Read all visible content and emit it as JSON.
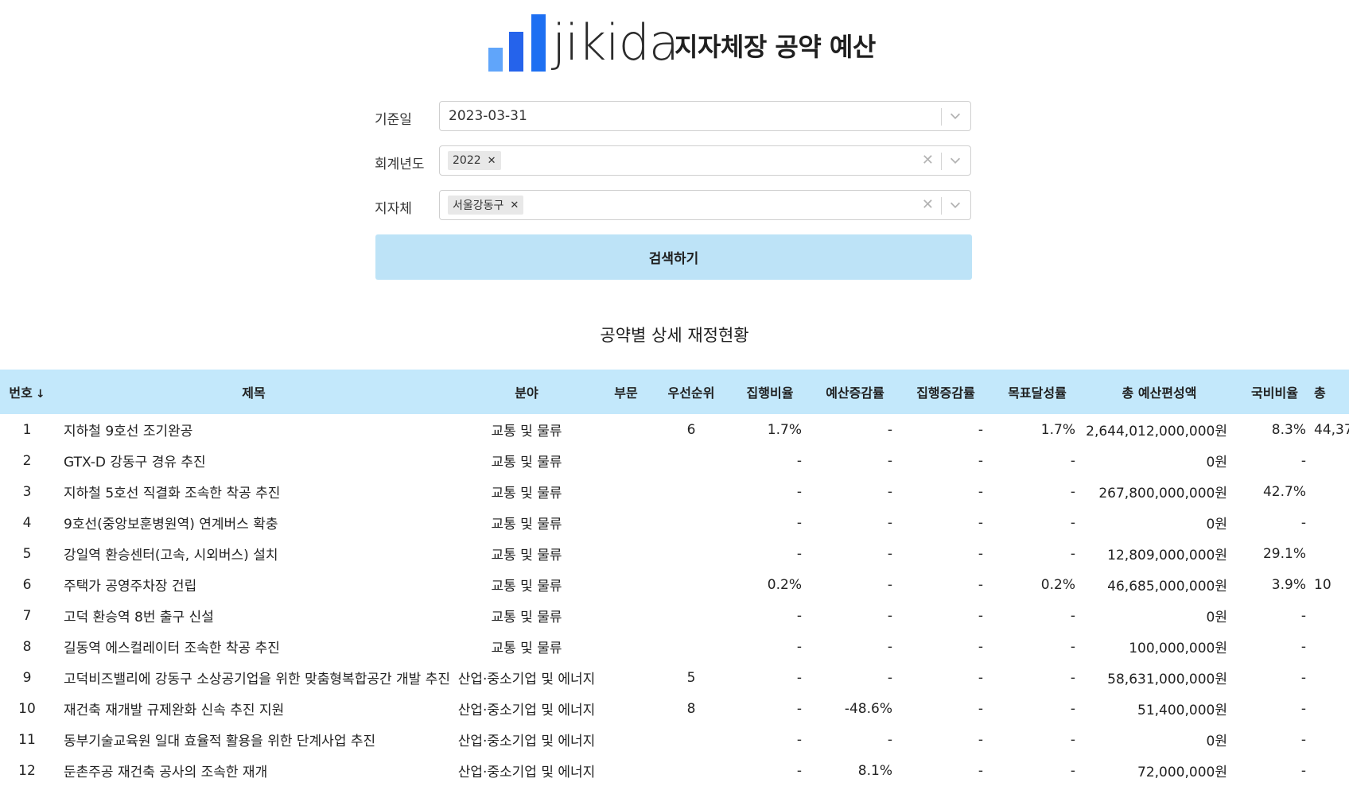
{
  "header": {
    "logo_text": "jikida",
    "title": "지자체장 공약 예산"
  },
  "form": {
    "date_label": "기준일",
    "date_value": "2023-03-31",
    "year_label": "회계년도",
    "year_chip": "2022",
    "region_label": "지자체",
    "region_chip": "서울강동구",
    "search_button": "검색하기"
  },
  "section_title": "공약별 상세 재정현황",
  "table": {
    "headers": [
      "번호",
      "제목",
      "분야",
      "부문",
      "우선순위",
      "집행비율",
      "예산증감률",
      "집행증감률",
      "목표달성률",
      "총 예산편성액",
      "국비비율",
      "총"
    ],
    "sort_icon": "arrow-down-icon",
    "rows": [
      [
        "1",
        "지하철 9호선 조기완공",
        "교통 및 물류",
        "",
        "6",
        "1.7%",
        "-",
        "-",
        "1.7%",
        "2,644,012,000,000원",
        "8.3%",
        "44,37"
      ],
      [
        "2",
        "GTX-D 강동구 경유 추진",
        "교통 및 물류",
        "",
        "",
        "-",
        "-",
        "-",
        "-",
        "0원",
        "-",
        ""
      ],
      [
        "3",
        "지하철 5호선 직결화 조속한 착공 추진",
        "교통 및 물류",
        "",
        "",
        "-",
        "-",
        "-",
        "-",
        "267,800,000,000원",
        "42.7%",
        ""
      ],
      [
        "4",
        "9호선(중앙보훈병원역) 연계버스 확충",
        "교통 및 물류",
        "",
        "",
        "-",
        "-",
        "-",
        "-",
        "0원",
        "-",
        ""
      ],
      [
        "5",
        "강일역 환승센터(고속, 시외버스) 설치",
        "교통 및 물류",
        "",
        "",
        "-",
        "-",
        "-",
        "-",
        "12,809,000,000원",
        "29.1%",
        ""
      ],
      [
        "6",
        "주택가 공영주차장 건립",
        "교통 및 물류",
        "",
        "",
        "0.2%",
        "-",
        "-",
        "0.2%",
        "46,685,000,000원",
        "3.9%",
        "10"
      ],
      [
        "7",
        "고덕 환승역 8번 출구 신설",
        "교통 및 물류",
        "",
        "",
        "-",
        "-",
        "-",
        "-",
        "0원",
        "-",
        ""
      ],
      [
        "8",
        "길동역 에스컬레이터 조속한 착공 추진",
        "교통 및 물류",
        "",
        "",
        "-",
        "-",
        "-",
        "-",
        "100,000,000원",
        "-",
        ""
      ],
      [
        "9",
        "고덕비즈밸리에 강동구 소상공기업을 위한 맞춤형복합공간 개발 추진",
        "산업·중소기업 및 에너지",
        "",
        "5",
        "-",
        "-",
        "-",
        "-",
        "58,631,000,000원",
        "-",
        ""
      ],
      [
        "10",
        "재건축 재개발 규제완화 신속 추진 지원",
        "산업·중소기업 및 에너지",
        "",
        "8",
        "-",
        "-48.6%",
        "-",
        "-",
        "51,400,000원",
        "-",
        ""
      ],
      [
        "11",
        "동부기술교육원 일대 효율적 활용을 위한 단계사업 추진",
        "산업·중소기업 및 에너지",
        "",
        "",
        "-",
        "-",
        "-",
        "-",
        "0원",
        "-",
        ""
      ],
      [
        "12",
        "둔촌주공 재건축 공사의 조속한 재개",
        "산업·중소기업 및 에너지",
        "",
        "",
        "-",
        "8.1%",
        "-",
        "-",
        "72,000,000원",
        "-",
        ""
      ]
    ]
  }
}
